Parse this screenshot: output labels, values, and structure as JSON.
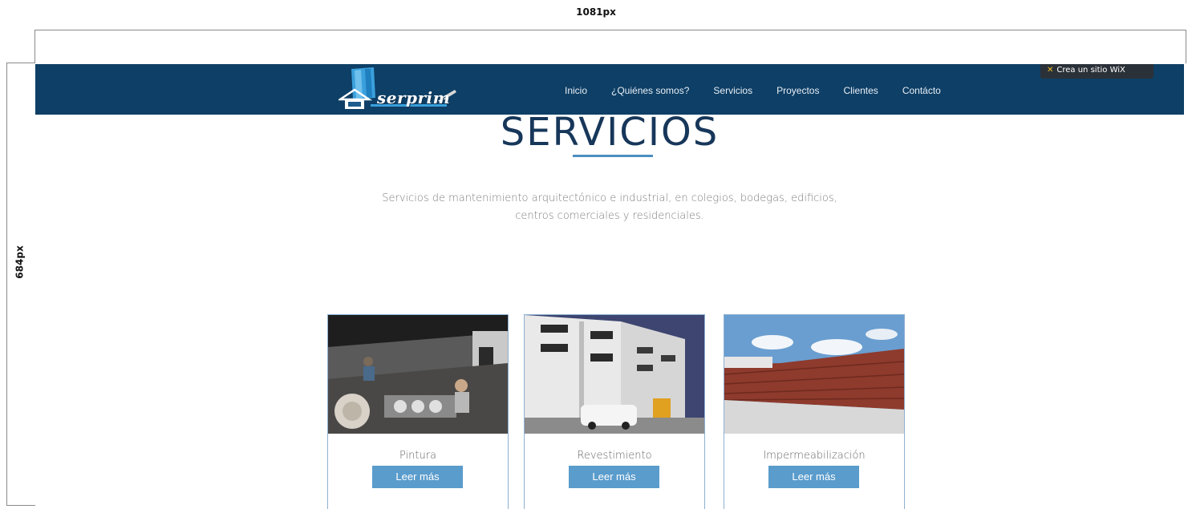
{
  "annotations": {
    "width_label": "1081px",
    "height_label": "684px"
  },
  "header": {
    "logo_text": "serprim",
    "nav": [
      "Inicio",
      "¿Quiénes somos?",
      "Servicios",
      "Proyectos",
      "Clientes",
      "Contácto"
    ],
    "wix_banner": "Crea un sitio WiX",
    "colors": {
      "nav_bg": "#0e3f66",
      "accent": "#5a9ccc"
    }
  },
  "main": {
    "title": "SERVICIOS",
    "intro_line1": "Servicios de mantenimiento arquitectónico e industrial, en colegios, bodegas, edificios,",
    "intro_line2": "centros comerciales y residenciales."
  },
  "services": [
    {
      "label": "Pintura",
      "button": "Leer más"
    },
    {
      "label": "Revestimiento",
      "button": "Leer más"
    },
    {
      "label": "Impermeabilización",
      "button": "Leer más"
    }
  ]
}
